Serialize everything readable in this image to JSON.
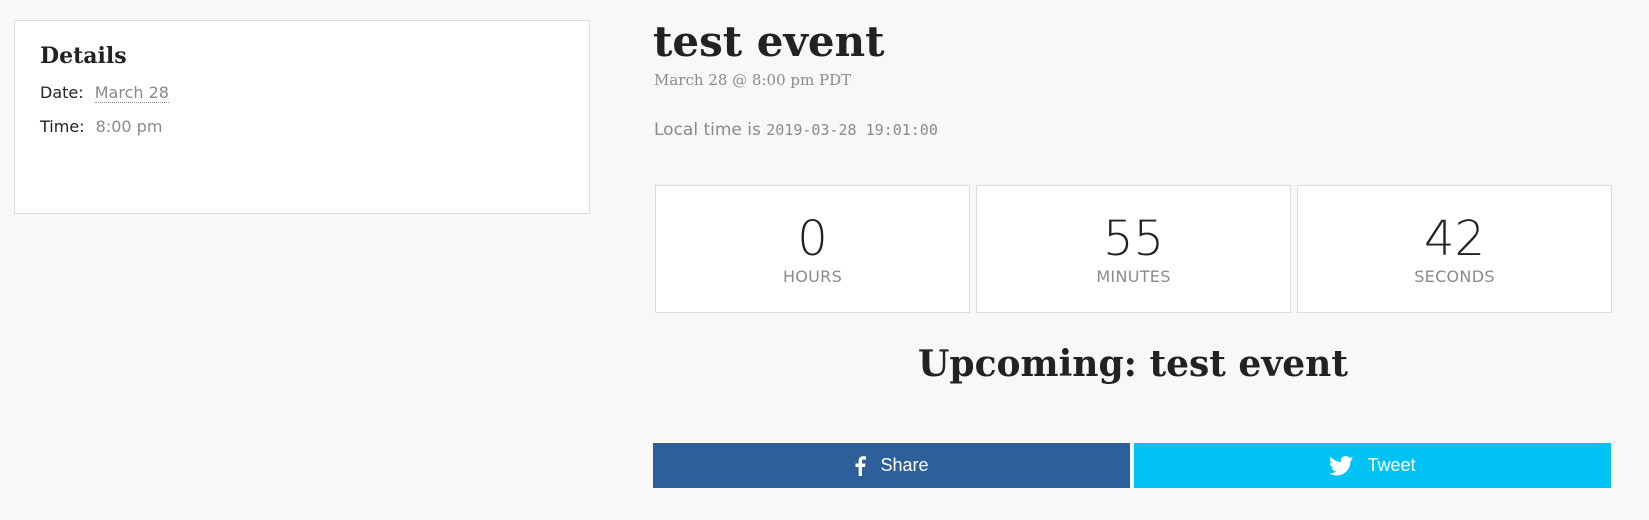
{
  "details": {
    "title": "Details",
    "date_label": "Date:",
    "date_value": "March 28",
    "time_label": "Time:",
    "time_value": "8:00 pm"
  },
  "event": {
    "title": "test event",
    "when": "March 28 @ 8:00 pm PDT",
    "local_time_prefix": "Local time is",
    "local_time_value": "2019-03-28 19:01:00"
  },
  "countdown": {
    "hours": "0",
    "hours_label": "HOURS",
    "minutes": "55",
    "minutes_label": "MINUTES",
    "seconds": "42",
    "seconds_label": "SECONDS"
  },
  "upcoming": "Upcoming: test event",
  "share": {
    "facebook_label": "Share",
    "facebook_icon": "facebook-icon",
    "facebook_color": "#2d5f9a",
    "twitter_label": "Tweet",
    "twitter_icon": "twitter-icon",
    "twitter_color": "#00c3f3"
  }
}
